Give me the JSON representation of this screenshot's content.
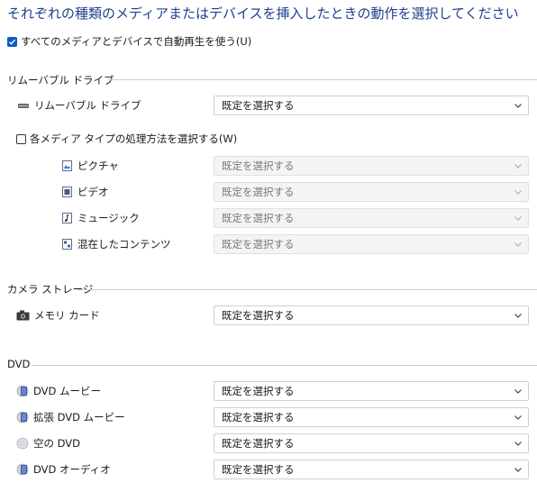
{
  "title": "それぞれの種類のメディアまたはデバイスを挿入したときの動作を選択してください",
  "autoplay_checkbox": {
    "label": "すべてのメディアとデバイスで自動再生を使う(U)",
    "checked": true
  },
  "removable": {
    "section": "リムーバブル ドライブ",
    "items": [
      {
        "label": "リムーバブル ドライブ",
        "icon": "removable-drive-icon",
        "value": "既定を選択する"
      }
    ]
  },
  "per_media_checkbox": {
    "label": "各メディア タイプの処理方法を選択する(W)",
    "checked": false
  },
  "media_items": [
    {
      "label": "ピクチャ",
      "icon": "picture-icon",
      "value": "既定を選択する"
    },
    {
      "label": "ビデオ",
      "icon": "video-icon",
      "value": "既定を選択する"
    },
    {
      "label": "ミュージック",
      "icon": "music-icon",
      "value": "既定を選択する"
    },
    {
      "label": "混在したコンテンツ",
      "icon": "mixed-content-icon",
      "value": "既定を選択する"
    }
  ],
  "camera": {
    "section": "カメラ ストレージ",
    "items": [
      {
        "label": "メモリ カード",
        "icon": "camera-icon",
        "value": "既定を選択する"
      }
    ]
  },
  "dvd": {
    "section": "DVD",
    "items": [
      {
        "label": "DVD ムービー",
        "icon": "dvd-movie-icon",
        "value": "既定を選択する"
      },
      {
        "label": "拡張 DVD ムービー",
        "icon": "enhanced-dvd-icon",
        "value": "既定を選択する"
      },
      {
        "label": "空の DVD",
        "icon": "blank-dvd-icon",
        "value": "既定を選択する"
      },
      {
        "label": "DVD オーディオ",
        "icon": "dvd-audio-icon",
        "value": "既定を選択する"
      }
    ]
  },
  "colors": {
    "accent": "#0b5cc5",
    "title": "#1f3f8f"
  }
}
